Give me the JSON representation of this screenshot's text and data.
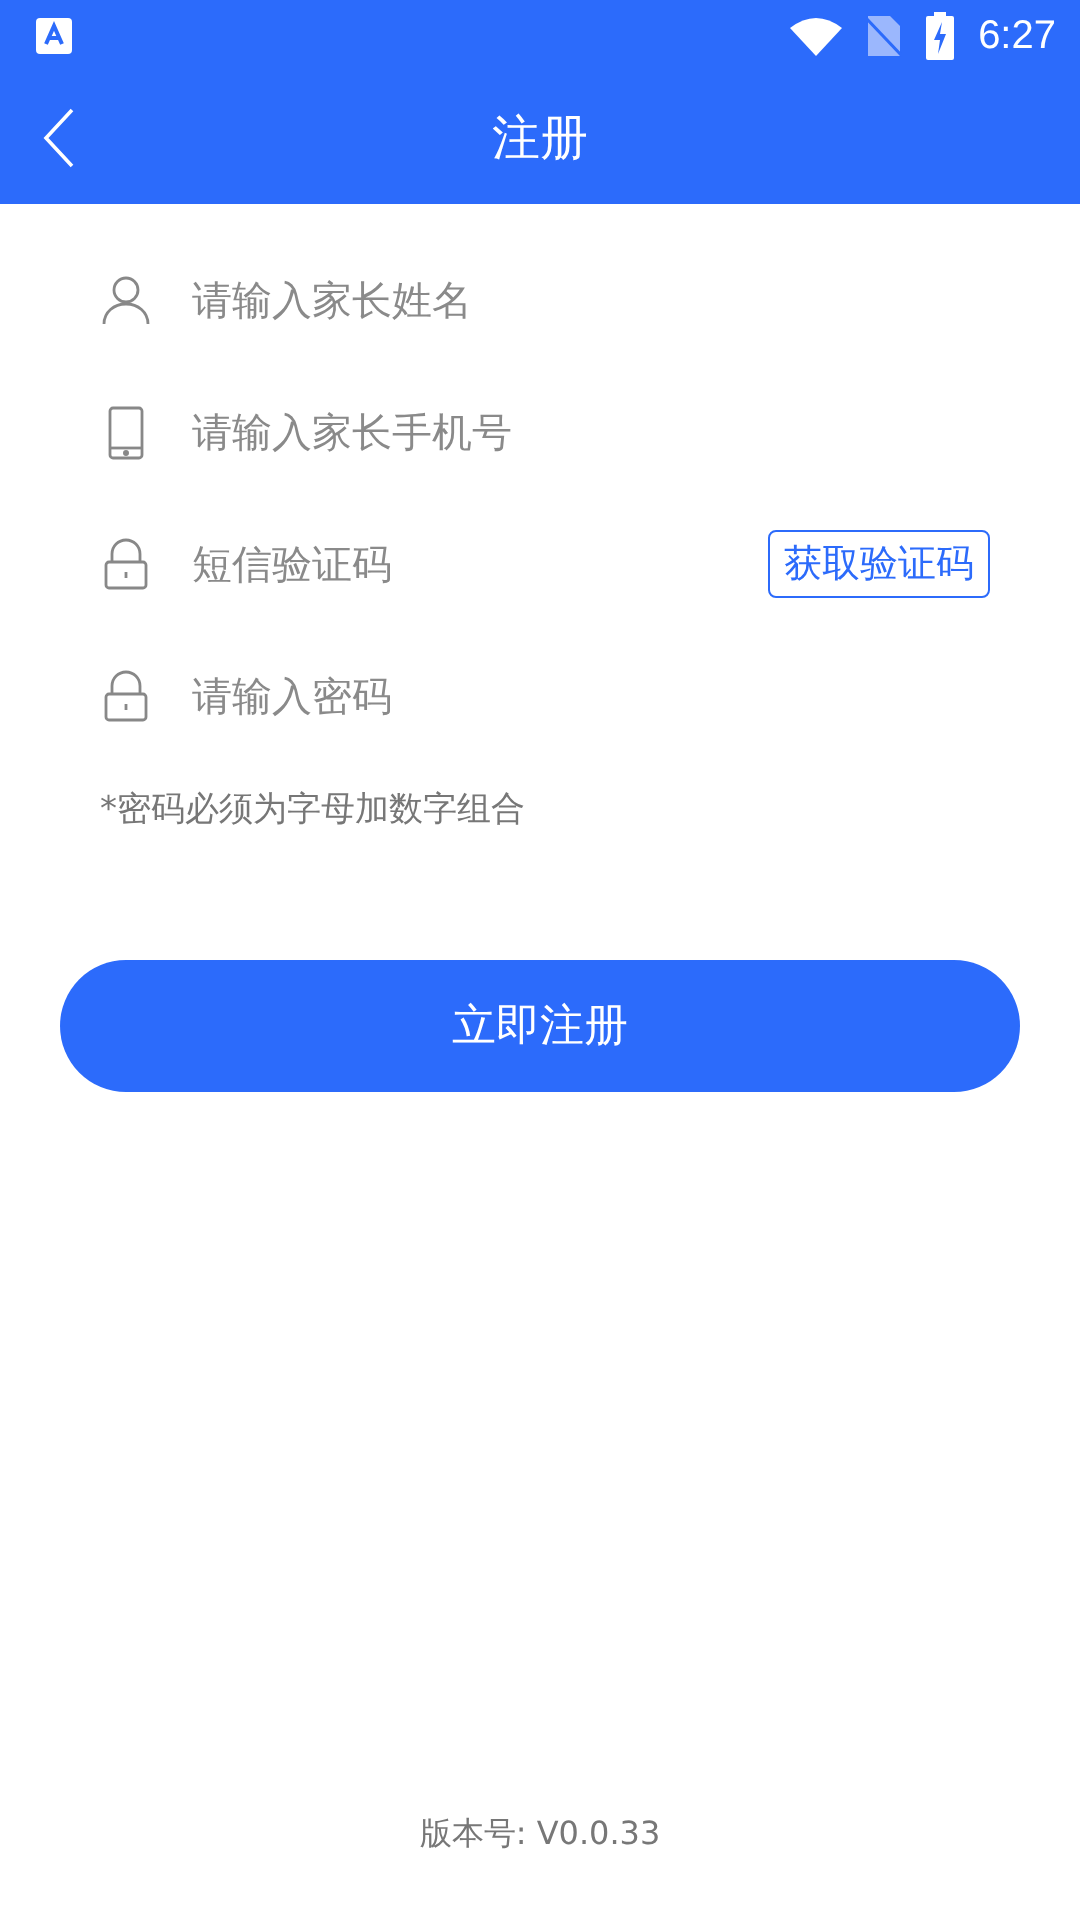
{
  "status_bar": {
    "time": "6:27"
  },
  "header": {
    "title": "注册"
  },
  "fields": [
    {
      "kind": "person",
      "placeholder": "请输入家长姓名"
    },
    {
      "kind": "phone",
      "placeholder": "请输入家长手机号"
    },
    {
      "kind": "lock",
      "placeholder": "短信验证码",
      "action": "获取验证码"
    },
    {
      "kind": "lock",
      "placeholder": "请输入密码"
    }
  ],
  "hint": "*密码必须为字母加数字组合",
  "submit": "立即注册",
  "version": "版本号: V0.0.33"
}
